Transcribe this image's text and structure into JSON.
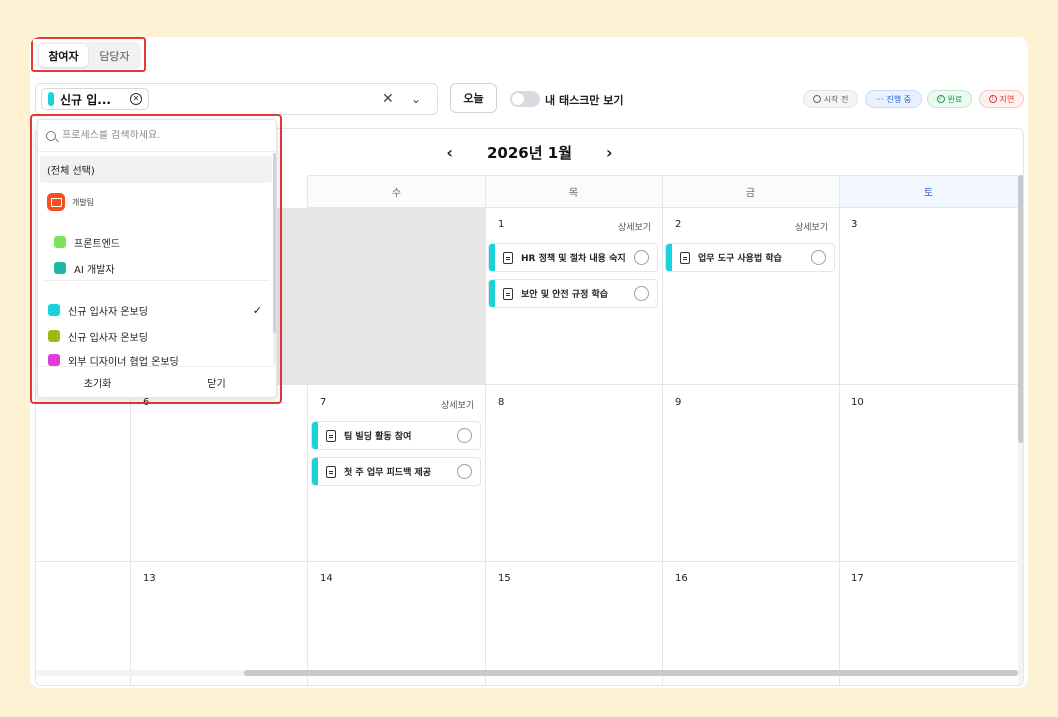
{
  "roles": {
    "tabs": [
      "참여자",
      "담당자"
    ],
    "active": 0
  },
  "toolbar": {
    "chip_label": "신규 입...",
    "chip_color": "#18d3d8",
    "today": "오늘",
    "my_tasks": "내 태스크만 보기",
    "my_tasks_on": false,
    "statuses": [
      "시작 전",
      "진행 중",
      "완료",
      "지연"
    ]
  },
  "calendar": {
    "title": "2026년 1월",
    "weekdays": [
      "수",
      "목",
      "금",
      "토"
    ],
    "detail": "상세보기",
    "days": {
      "d1": "1",
      "d2": "2",
      "d3": "3",
      "d6": "6",
      "d7": "7",
      "d8": "8",
      "d9": "9",
      "d10": "10",
      "d13": "13",
      "d14": "14",
      "d15": "15",
      "d16": "16",
      "d17": "17"
    },
    "tasks": {
      "t1": "HR 정책 및 절차 내용 숙지",
      "t2": "보안 및 안전 규정 학습",
      "t3": "업무 도구 사용법 학습",
      "t4": "팀 빌딩 활동 참여",
      "t5": "첫 주 업무 피드백 제공"
    }
  },
  "dropdown": {
    "search_placeholder": "프로세스를 검색하세요.",
    "select_all": "(전체 선택)",
    "group": "개발팀",
    "group_items": [
      {
        "label": "프론트엔드",
        "color": "#7ee35a"
      },
      {
        "label": "AI 개발자",
        "color": "#1fb8a6"
      }
    ],
    "processes": [
      {
        "label": "신규 입사자 온보딩",
        "color": "#18d3d8",
        "checked": true
      },
      {
        "label": "신규 입사자 온보딩",
        "color": "#9cbb12",
        "checked": false
      },
      {
        "label": "외부 디자이너 협업 온보딩",
        "color": "#e23bd8",
        "checked": false
      }
    ],
    "reset": "초기화",
    "close": "닫기"
  }
}
